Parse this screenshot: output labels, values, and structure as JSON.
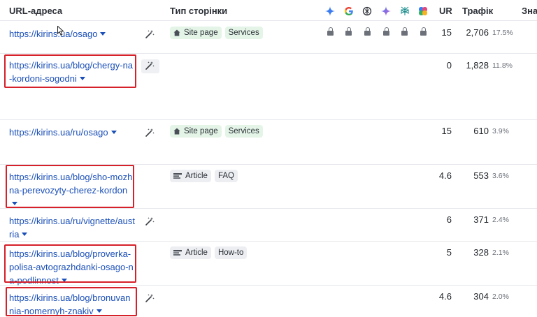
{
  "header": {
    "url_label": "URL-адреса",
    "type_label": "Тип сторінки",
    "ur_label": "UR",
    "traffic_label": "Трафік",
    "value_label": "Зна",
    "ai_icons": [
      "gemini-icon",
      "google-icon",
      "openai-icon",
      "gemini-sparkle-icon",
      "perplexity-icon",
      "copilot-icon"
    ]
  },
  "rows": [
    {
      "url": "https://kirins.ua/osago",
      "tags": [
        {
          "label": "Site page",
          "kind": "site"
        },
        {
          "label": "Services",
          "kind": "plain-green"
        }
      ],
      "locked": true,
      "ur": "15",
      "traffic": "2,706",
      "pct": "17.5%",
      "highlighted": false
    },
    {
      "url": "https://kirins.ua/blog/chergy-na-kordoni-sogodni",
      "tags": [],
      "locked": false,
      "ur": "0",
      "traffic": "1,828",
      "pct": "11.8%",
      "highlighted": true
    },
    {
      "url": "https://kirins.ua/ru/osago",
      "tags": [
        {
          "label": "Site page",
          "kind": "site"
        },
        {
          "label": "Services",
          "kind": "plain-green"
        }
      ],
      "locked": false,
      "ur": "15",
      "traffic": "610",
      "pct": "3.9%",
      "highlighted": false
    },
    {
      "url": "https://kirins.ua/blog/sho-mozhna-perevozyty-cherez-kordon",
      "tags": [
        {
          "label": "Article",
          "kind": "article"
        },
        {
          "label": "FAQ",
          "kind": "plain-gray"
        }
      ],
      "locked": false,
      "ur": "4.6",
      "traffic": "553",
      "pct": "3.6%",
      "highlighted": true
    },
    {
      "url": "https://kirins.ua/ru/vignette/austria",
      "tags": [],
      "locked": false,
      "ur": "6",
      "traffic": "371",
      "pct": "2.4%",
      "highlighted": false
    },
    {
      "url": "https://kirins.ua/blog/proverka-polisa-avtograzhdanki-osago-na-podlinnost",
      "tags": [
        {
          "label": "Article",
          "kind": "article"
        },
        {
          "label": "How-to",
          "kind": "plain-gray"
        }
      ],
      "locked": false,
      "ur": "5",
      "traffic": "328",
      "pct": "2.1%",
      "highlighted": true
    },
    {
      "url": "https://kirins.ua/blog/bronuvannia-nomernyh-znakiv",
      "tags": [],
      "locked": false,
      "ur": "4.6",
      "traffic": "304",
      "pct": "2.0%",
      "highlighted": true
    }
  ],
  "colors": {
    "link": "#1a4fb8",
    "highlight": "#d6202a",
    "tag_green": "#e4f5e8",
    "tag_gray": "#eceef2"
  }
}
